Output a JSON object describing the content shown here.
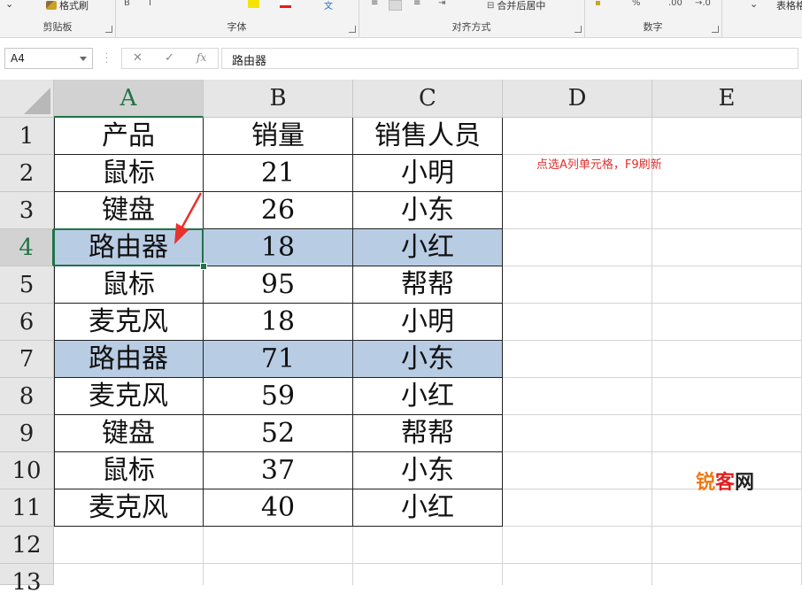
{
  "ribbon": {
    "format_painter": "格式刷",
    "groups": [
      {
        "label": "剪贴板"
      },
      {
        "label": "字体"
      },
      {
        "label": "对齐方式"
      },
      {
        "label": "数字"
      }
    ],
    "merge_label": "合并后居中",
    "percent": "%",
    "decimal_inc": ".00",
    "decimal_dec": "→.0",
    "table_format": "表格格"
  },
  "formula_bar": {
    "name_box": "A4",
    "cancel": "✕",
    "confirm": "✓",
    "fx": "fx",
    "value": "路由器"
  },
  "columns": [
    "A",
    "B",
    "C",
    "D",
    "E"
  ],
  "rows": [
    "1",
    "2",
    "3",
    "4",
    "5",
    "6",
    "7",
    "8",
    "9",
    "10",
    "11",
    "12",
    "13"
  ],
  "table": {
    "headers": [
      "产品",
      "销量",
      "销售人员"
    ],
    "rows": [
      [
        "鼠标",
        "21",
        "小明"
      ],
      [
        "键盘",
        "26",
        "小东"
      ],
      [
        "路由器",
        "18",
        "小红"
      ],
      [
        "鼠标",
        "95",
        "帮帮"
      ],
      [
        "麦克风",
        "18",
        "小明"
      ],
      [
        "路由器",
        "71",
        "小东"
      ],
      [
        "麦克风",
        "59",
        "小红"
      ],
      [
        "键盘",
        "52",
        "帮帮"
      ],
      [
        "鼠标",
        "37",
        "小东"
      ],
      [
        "麦克风",
        "40",
        "小红"
      ]
    ],
    "highlighted_rows": [
      4,
      7
    ]
  },
  "annotation": "点选A列单元格，F9刷新",
  "watermark": {
    "part1": "锐",
    "part2": "客",
    "part3": "网"
  },
  "colors": {
    "highlight": "#b8cce4",
    "selection": "#217346",
    "annotation": "#e0312e",
    "arrow": "#e8322b"
  }
}
